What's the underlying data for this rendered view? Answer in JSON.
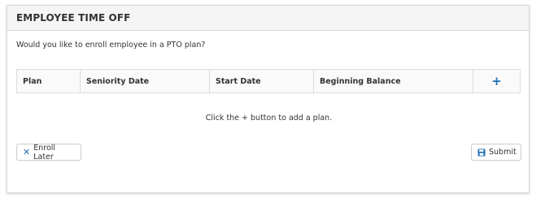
{
  "panel": {
    "title": "EMPLOYEE TIME OFF",
    "prompt": "Would you like to enroll employee in a PTO plan?",
    "empty_message": "Click the + button to add a plan."
  },
  "table": {
    "columns": [
      "Plan",
      "Seniority Date",
      "Start Date",
      "Beginning Balance"
    ],
    "add_label": "+",
    "rows": []
  },
  "buttons": {
    "enroll_later": {
      "label": "Enroll Later",
      "icon": "close-icon"
    },
    "submit": {
      "label": "Submit",
      "icon": "save-icon"
    }
  },
  "colors": {
    "accent": "#1f6fb4",
    "header_bg": "#f5f5f5",
    "border": "#dddddd"
  }
}
